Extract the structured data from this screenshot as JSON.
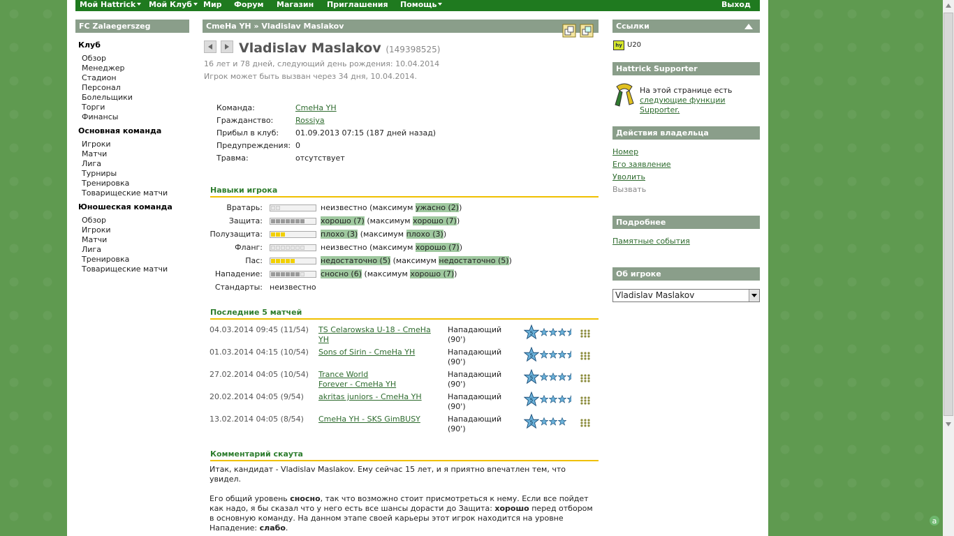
{
  "nav": {
    "items": [
      {
        "label": "Мой Hattrick",
        "dropdown": true
      },
      {
        "label": "Мой Клуб",
        "dropdown": true
      },
      {
        "label": "Мир",
        "dropdown": false
      },
      {
        "label": "Форум",
        "dropdown": false
      },
      {
        "label": "Магазин",
        "dropdown": false
      },
      {
        "label": "Приглашения",
        "dropdown": false
      },
      {
        "label": "Помощь",
        "dropdown": true
      }
    ],
    "logout": "Выход"
  },
  "left": {
    "club_name": "FC Zalaegerszeg",
    "sections": [
      {
        "title": "Клуб",
        "links": [
          "Обзор",
          "Менеджер",
          "Стадион",
          "Персонал",
          "Болельщики",
          "Торги",
          "Финансы"
        ]
      },
      {
        "title": "Основная команда",
        "links": [
          "Игроки",
          "Матчи",
          "Лига",
          "Турниры",
          "Тренировка",
          "Товарищеские матчи"
        ]
      },
      {
        "title": "Юношеская команда",
        "links": [
          "Обзор",
          "Игроки",
          "Матчи",
          "Лига",
          "Тренировка",
          "Товарищеские матчи"
        ]
      }
    ]
  },
  "main": {
    "breadcrumb_team": "CmeHa YH",
    "breadcrumb_sep": "»",
    "breadcrumb_player": "Vladislav Maslakov",
    "player_name": "Vladislav Maslakov",
    "player_id": "(149398525)",
    "age_line": "16 лет и 78 дней, следующий день рождения: 10.04.2014",
    "callup_line": "Игрок может быть вызван через 34 дня, 10.04.2014.",
    "info": [
      {
        "label": "Команда:",
        "value": "CmeHa YH",
        "link": true
      },
      {
        "label": "Гражданство:",
        "value": "Rossiya",
        "link": true
      },
      {
        "label": "Прибыл в клуб:",
        "value": "01.09.2013 07:15 (187 дней назад)",
        "link": false
      },
      {
        "label": "Предупреждения:",
        "value": "0",
        "link": false
      },
      {
        "label": "Травма:",
        "value": "отсутствует",
        "link": false
      }
    ],
    "skills_title": "Навыки игрока",
    "skills": [
      {
        "name": "Вратарь:",
        "level": 0,
        "max": 2,
        "parts": [
          {
            "t": "неизвестно",
            "hl": false
          },
          {
            "t": " (максимум ",
            "hl": false
          },
          {
            "t": "ужасно (2)",
            "hl": true
          },
          {
            "t": ")",
            "hl": false
          }
        ]
      },
      {
        "name": "Защита:",
        "level": 7,
        "max": 7,
        "parts": [
          {
            "t": "хорошо (7)",
            "hl": true
          },
          {
            "t": " (максимум ",
            "hl": false
          },
          {
            "t": "хорошо (7)",
            "hl": true
          },
          {
            "t": ")",
            "hl": false
          }
        ]
      },
      {
        "name": "Полузащита:",
        "level": 3,
        "max": 3,
        "parts": [
          {
            "t": "плохо (3)",
            "hl": true
          },
          {
            "t": " (максимум ",
            "hl": false
          },
          {
            "t": "плохо (3)",
            "hl": true
          },
          {
            "t": ")",
            "hl": false
          }
        ]
      },
      {
        "name": "Фланг:",
        "level": 0,
        "max": 7,
        "parts": [
          {
            "t": "неизвестно",
            "hl": false
          },
          {
            "t": " (максимум ",
            "hl": false
          },
          {
            "t": "хорошо (7)",
            "hl": true
          },
          {
            "t": ")",
            "hl": false
          }
        ]
      },
      {
        "name": "Пас:",
        "level": 5,
        "max": 5,
        "parts": [
          {
            "t": "недостаточно (5)",
            "hl": true
          },
          {
            "t": " (максимум ",
            "hl": false
          },
          {
            "t": "недостаточно (5)",
            "hl": true
          },
          {
            "t": ")",
            "hl": false
          }
        ]
      },
      {
        "name": "Нападение:",
        "level": 6,
        "max": 7,
        "parts": [
          {
            "t": "сносно (6)",
            "hl": true
          },
          {
            "t": " (максимум ",
            "hl": false
          },
          {
            "t": "хорошо (7)",
            "hl": true
          },
          {
            "t": ")",
            "hl": false
          }
        ]
      },
      {
        "name": "Стандарты:",
        "level": null,
        "max": null,
        "parts": [
          {
            "t": "неизвестно",
            "hl": false
          }
        ]
      }
    ],
    "matches_title": "Последние 5 матчей",
    "matches": [
      {
        "date": "04.03.2014 09:45 (11/54)",
        "match": [
          "TS Celarowska U-18 - CmeHa",
          "YH"
        ],
        "pos": "Нападающий",
        "min": "(90')",
        "stars": 5,
        "small": 3.5
      },
      {
        "date": "01.03.2014 04:15 (10/54)",
        "match": [
          "Sons of Sirin - CmeHa YH"
        ],
        "pos": "Нападающий",
        "min": "(90')",
        "stars": 5,
        "small": 3.5
      },
      {
        "date": "27.02.2014 04:05 (10/54)",
        "match": [
          "Trance World",
          "Forever - CmeHa YH"
        ],
        "pos": "Нападающий",
        "min": "(90')",
        "stars": 5,
        "small": 3.5
      },
      {
        "date": "20.02.2014 04:05 (9/54)",
        "match": [
          "akritas juniors - CmeHa YH"
        ],
        "pos": "Нападающий",
        "min": "(90')",
        "stars": 5,
        "small": 3.5
      },
      {
        "date": "13.02.2014 04:05 (8/54)",
        "match": [
          "CmeHa YH - SKS GimBUSY"
        ],
        "pos": "Нападающий",
        "min": "(90')",
        "stars": 5,
        "small": 3
      }
    ],
    "scout_title": "Комментарий скаута",
    "scout_p1": "Итак, кандидат - Vladislav Maslakov. Ему сейчас 15 лет, и я приятно впечатлен тем, что увидел.",
    "scout_p2_a": "Его общий уровень ",
    "scout_p2_b": "сносно",
    "scout_p2_c": ", так что возможно стоит присмотреться к нему. Если все пойдет как надо, я бы сказал что у него есть все шансы дорасти до Защита: ",
    "scout_p2_d": "хорошо",
    "scout_p2_e": " перед отбором в основную команду. На данном этапе своей карьеры этот игрок находится на уровне Нападение: ",
    "scout_p2_f": "слабо",
    "scout_p2_g": "."
  },
  "right": {
    "links_title": "Ссылки",
    "u20_label": "U20",
    "supporter_title": "Hattrick Supporter",
    "supporter_text": "На этой странице есть",
    "supporter_link": "следующие функции Supporter",
    "supporter_dot": ".",
    "owner_title": "Действия владельца",
    "owner_links": [
      "Номер",
      "Его заявление",
      "Уволить"
    ],
    "owner_disabled": "Вызвать",
    "more_title": "Подробнее",
    "more_link": "Памятные события",
    "about_title": "Об игроке",
    "about_select": "Vladislav Maslakov"
  },
  "colors": {
    "nav": "#1f7a1f",
    "box_header": "#8a9e8a",
    "accent_line": "#f0c000",
    "link": "#2e6b2e"
  }
}
